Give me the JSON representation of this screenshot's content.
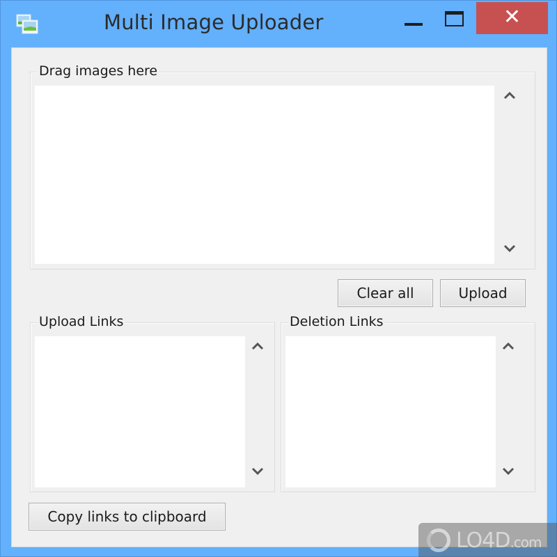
{
  "window": {
    "title": "Multi Image Uploader",
    "icon": "image-gallery-icon",
    "controls": {
      "minimize": "minimize-icon",
      "maximize": "maximize-icon",
      "close_glyph": "✕"
    }
  },
  "drag_area": {
    "label": "Drag images here",
    "items": []
  },
  "actions": {
    "clear_all_label": "Clear all",
    "upload_label": "Upload"
  },
  "upload_links": {
    "label": "Upload Links",
    "items": []
  },
  "deletion_links": {
    "label": "Deletion Links",
    "items": []
  },
  "footer": {
    "copy_label": "Copy links to clipboard"
  },
  "watermark": {
    "brand": "LO4D",
    "suffix": ".com"
  },
  "colors": {
    "titlebar": "#63b0fc",
    "close_button": "#c75050",
    "client_bg": "#f0f0f0"
  }
}
